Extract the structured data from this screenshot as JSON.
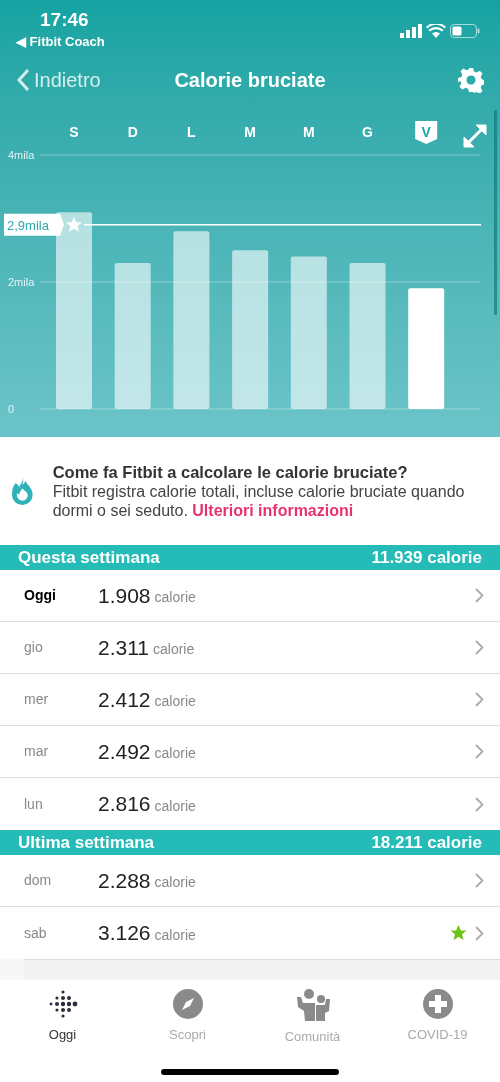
{
  "status_bar": {
    "time": "17:46",
    "back_app": "◀ Fitbit Coach"
  },
  "nav": {
    "back": "Indietro",
    "title": "Calorie bruciate"
  },
  "chart_data": {
    "type": "bar",
    "categories": [
      {
        "label": "S",
        "selected": false
      },
      {
        "label": "D",
        "selected": false
      },
      {
        "label": "L",
        "selected": false
      },
      {
        "label": "M",
        "selected": false
      },
      {
        "label": "M",
        "selected": false
      },
      {
        "label": "G",
        "selected": false
      },
      {
        "label": "V",
        "selected": true
      }
    ],
    "values": [
      3.1,
      2.3,
      2.8,
      2.5,
      2.4,
      2.3,
      1.9
    ],
    "ylim": [
      0,
      4
    ],
    "yticks": [
      {
        "value": 0,
        "label": "0"
      },
      {
        "value": 2,
        "label": "2mila"
      },
      {
        "value": 4,
        "label": "4mila"
      }
    ],
    "ref_lines": [
      {
        "axis": "y",
        "value": 2.9,
        "label": "2,9mila"
      }
    ]
  },
  "info": {
    "title": "Come fa Fitbit a calcolare le calorie bruciate?",
    "text": "Fitbit registra calorie totali, incluse calorie bruciate quando dormi o sei seduto.",
    "link": "Ulteriori informazioni"
  },
  "sections": [
    {
      "title": "Questa settimana",
      "total": "11.939 calorie",
      "rows": [
        {
          "day": "Oggi",
          "value": "1.908",
          "unit": "calorie",
          "today": true,
          "goal_met": false
        },
        {
          "day": "gio",
          "value": "2.311",
          "unit": "calorie",
          "today": false,
          "goal_met": false
        },
        {
          "day": "mer",
          "value": "2.412",
          "unit": "calorie",
          "today": false,
          "goal_met": false
        },
        {
          "day": "mar",
          "value": "2.492",
          "unit": "calorie",
          "today": false,
          "goal_met": false
        },
        {
          "day": "lun",
          "value": "2.816",
          "unit": "calorie",
          "today": false,
          "goal_met": false
        }
      ]
    },
    {
      "title": "Ultima settimana",
      "total": "18.211 calorie",
      "rows": [
        {
          "day": "dom",
          "value": "2.288",
          "unit": "calorie",
          "today": false,
          "goal_met": false
        },
        {
          "day": "sab",
          "value": "3.126",
          "unit": "calorie",
          "today": false,
          "goal_met": true
        }
      ]
    }
  ],
  "tab_bar": [
    {
      "label": "Oggi",
      "kind": "dots",
      "selected": true
    },
    {
      "label": "Scopri",
      "kind": "compass",
      "selected": false
    },
    {
      "label": "Comunità",
      "kind": "people",
      "selected": false
    },
    {
      "label": "COVID-19",
      "kind": "plus",
      "selected": false
    }
  ]
}
